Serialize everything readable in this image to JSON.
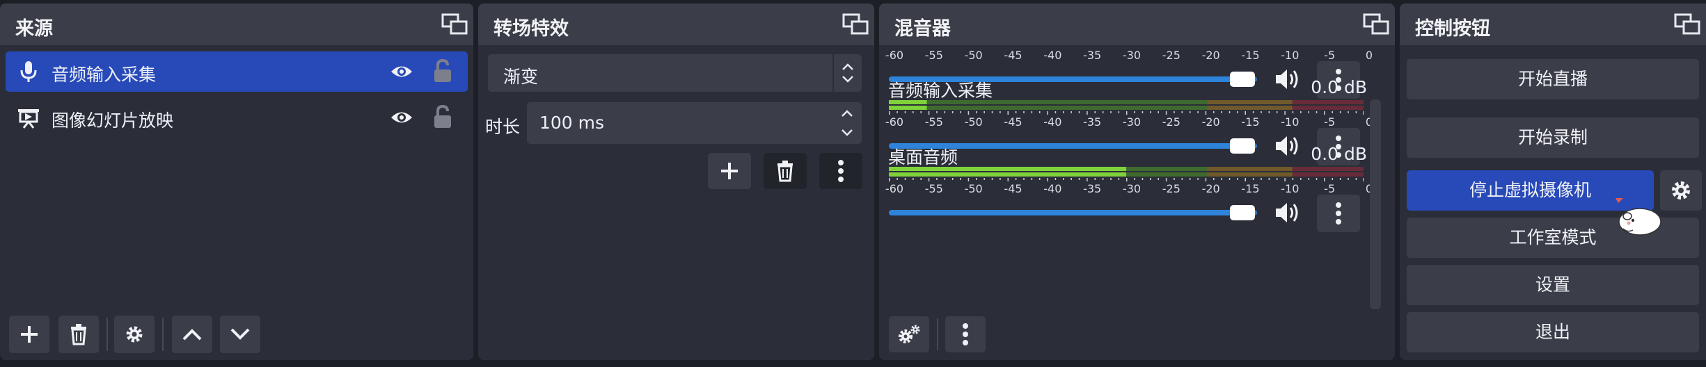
{
  "sources": {
    "title": "来源",
    "items": [
      {
        "label": "音频输入采集",
        "selected": true,
        "icon": "microphone-icon"
      },
      {
        "label": "图像幻灯片放映",
        "selected": false,
        "icon": "slideshow-icon"
      }
    ],
    "toolbar_icons": [
      "plus-icon",
      "trash-icon",
      "gear-icon",
      "chevron-up-icon",
      "chevron-down-icon"
    ]
  },
  "transitions": {
    "title": "转场特效",
    "selected": "渐变",
    "duration_label": "时长",
    "duration_value": "100 ms",
    "toolbar_icons": [
      "plus-icon",
      "trash-icon",
      "kebab-icon"
    ]
  },
  "mixer": {
    "title": "混音器",
    "scale": [
      "-60",
      "-55",
      "-50",
      "-45",
      "-40",
      "-35",
      "-30",
      "-25",
      "-20",
      "-15",
      "-10",
      "-5",
      "0"
    ],
    "channels": [
      {
        "name": "",
        "db": "",
        "volume": 0.96,
        "partial": true
      },
      {
        "name": "音频输入采集",
        "db": "0.0 dB",
        "volume": 0.96,
        "level": 0.08
      },
      {
        "name": "桌面音频",
        "db": "0.0 dB",
        "volume": 0.96,
        "level": 0.5
      }
    ],
    "toolbar_icons": [
      "gears-icon",
      "kebab-icon"
    ]
  },
  "controls": {
    "title": "控制按钮",
    "buttons": [
      "开始直播",
      "开始录制",
      "停止虚拟摄像机",
      "工作室模式",
      "设置",
      "退出"
    ],
    "active_index": 2
  },
  "colors": {
    "accent": "#284ab8",
    "meter_green": "#4f9c2a",
    "meter_yellow": "#a97e20",
    "meter_red": "#9b2a3a",
    "slider": "#2e83db"
  }
}
